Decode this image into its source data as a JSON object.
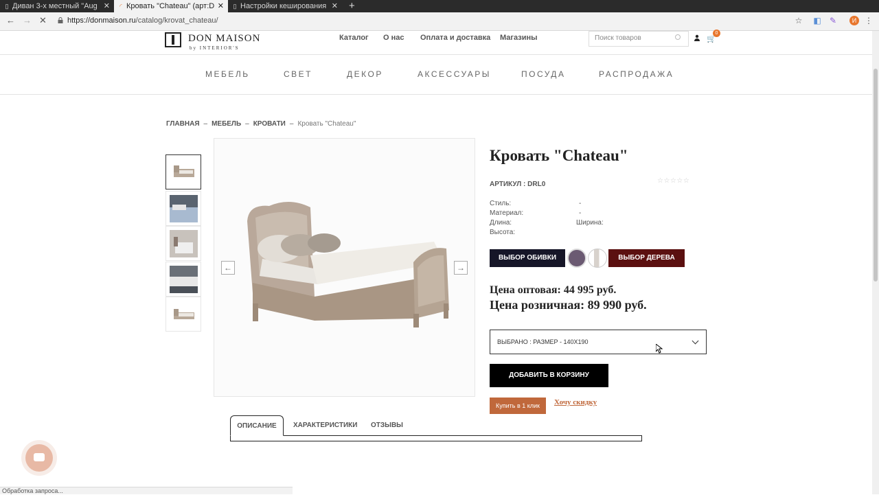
{
  "browser": {
    "tabs": [
      {
        "title": "Диван 3-х местный \"Aug",
        "active": false
      },
      {
        "title": "Кровать \"Chateau\" (арт:D",
        "active": true
      },
      {
        "title": "Настройки кеширования",
        "active": false
      }
    ],
    "url_host": "https://donmaison.ru",
    "url_path": "/catalog/krovat_chateau/",
    "profile_letter": "И",
    "status": "Обработка запроса..."
  },
  "header": {
    "logo_title": "DON MAISON",
    "logo_sub": "by INTERIOR'S",
    "nav": [
      "Каталог",
      "О нас",
      "Оплата и доставка",
      "Магазины"
    ],
    "search_placeholder": "Поиск товаров",
    "cart_count": "0"
  },
  "catnav": [
    "МЕБЕЛЬ",
    "СВЕТ",
    "ДЕКОР",
    "АКСЕССУАРЫ",
    "ПОСУДА",
    "РАСПРОДАЖА"
  ],
  "breadcrumb": {
    "items": [
      "ГЛАВНАЯ",
      "МЕБЕЛЬ",
      "КРОВАТИ"
    ],
    "separator": "–",
    "current": "Кровать \"Chateau\""
  },
  "product": {
    "title": "Кровать \"Chateau\"",
    "sku": "АРТИКУЛ : DRL0",
    "rating": "☆☆☆☆☆",
    "specs": {
      "style_label": "Стиль:",
      "style_value": "-",
      "material_label": "Материал:",
      "material_value": "-",
      "length_label": "Длина:",
      "width_label": "Ширина:",
      "height_label": "Высота:"
    },
    "upholstery_button": "ВЫБОР ОБИВКИ",
    "wood_button": "ВЫБОР ДЕРЕВА",
    "swatch_colors": [
      "#6b5a72",
      "#d8d2cc"
    ],
    "price_wholesale": "Цена оптовая: 44 995 руб.",
    "price_retail": "Цена розничная: 89 990 руб.",
    "selected_size": "ВЫБРАНО : РАЗМЕР - 140Х190",
    "add_to_cart": "ДОБАВИТЬ В КОРЗИНУ",
    "one_click": "Купить в 1 клик",
    "discount": "Хочу скидку"
  },
  "tabs": [
    "ОПИСАНИЕ",
    "ХАРАКТЕРИСТИКИ",
    "ОТЗЫВЫ"
  ],
  "colors": {
    "accent": "#c0683b",
    "dark_button": "#161628",
    "wood_button": "#5b1010"
  }
}
